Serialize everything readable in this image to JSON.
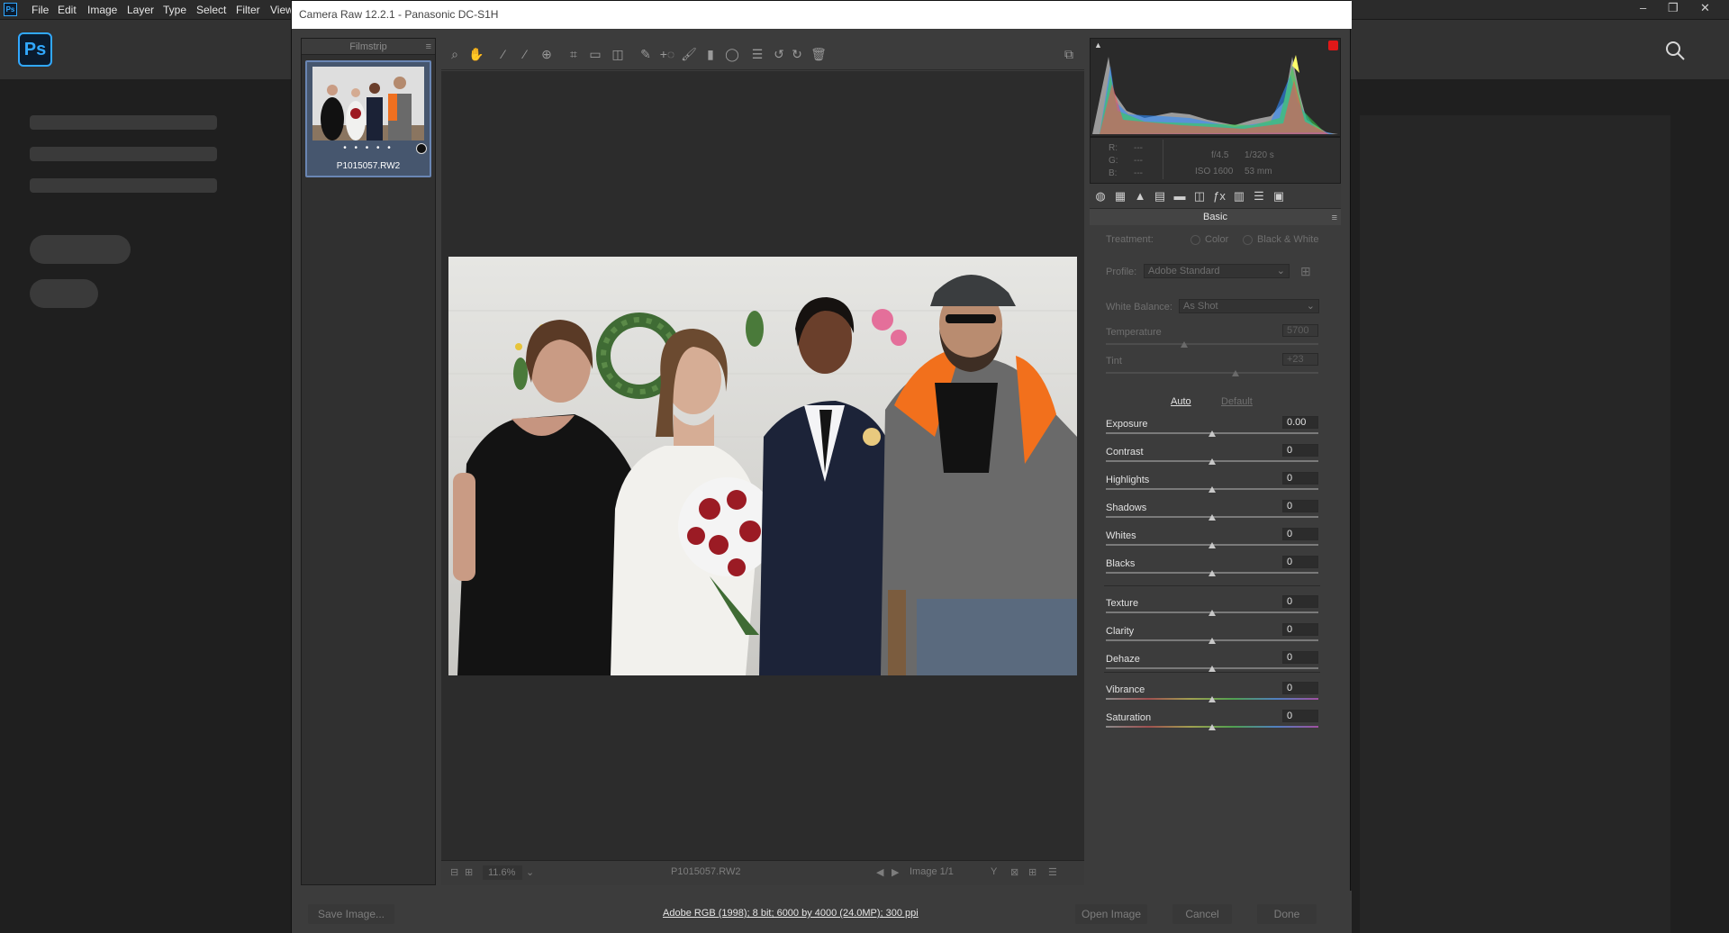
{
  "ps": {
    "logo_small": "Ps",
    "logo": "Ps",
    "menu": [
      "File",
      "Edit",
      "Image",
      "Layer",
      "Type",
      "Select",
      "Filter",
      "View"
    ]
  },
  "dialog": {
    "title": "Camera Raw 12.2.1  -  Panasonic DC-S1H",
    "filmstrip_label": "Filmstrip",
    "thumb_stars": "• • • • •",
    "thumb_name": "P1015057.RW2",
    "footer": {
      "zoom": "11.6%",
      "filename": "P1015057.RW2",
      "image_counter": "Image 1/1"
    },
    "info": {
      "r": "R:",
      "g": "G:",
      "b": "B:",
      "r_val": "---",
      "g_val": "---",
      "b_val": "---",
      "aperture": "f/4.5",
      "shutter": "1/320 s",
      "iso": "ISO 1600",
      "focal": "53 mm"
    },
    "panel": {
      "title": "Basic",
      "treatment_label": "Treatment:",
      "treatment_color": "Color",
      "treatment_bw": "Black & White",
      "profile_label": "Profile:",
      "profile_value": "Adobe Standard",
      "wb_label": "White Balance:",
      "wb_value": "As Shot",
      "temperature_label": "Temperature",
      "temperature_value": "5700",
      "tint_label": "Tint",
      "tint_value": "+23",
      "auto": "Auto",
      "default": "Default",
      "sliders": [
        {
          "label": "Exposure",
          "value": "0.00",
          "pos": 0.5
        },
        {
          "label": "Contrast",
          "value": "0",
          "pos": 0.5
        },
        {
          "label": "Highlights",
          "value": "0",
          "pos": 0.5
        },
        {
          "label": "Shadows",
          "value": "0",
          "pos": 0.5
        },
        {
          "label": "Whites",
          "value": "0",
          "pos": 0.5
        },
        {
          "label": "Blacks",
          "value": "0",
          "pos": 0.5
        }
      ],
      "sliders2": [
        {
          "label": "Texture",
          "value": "0",
          "pos": 0.5
        },
        {
          "label": "Clarity",
          "value": "0",
          "pos": 0.5
        },
        {
          "label": "Dehaze",
          "value": "0",
          "pos": 0.5
        }
      ],
      "sliders3": [
        {
          "label": "Vibrance",
          "value": "0",
          "pos": 0.5
        },
        {
          "label": "Saturation",
          "value": "0",
          "pos": 0.5
        }
      ],
      "temp_pos": 0.37,
      "tint_pos": 0.61
    },
    "bottom": {
      "save": "Save Image...",
      "workflow": "Adobe RGB (1998); 8 bit; 6000 by 4000 (24.0MP); 300 ppi",
      "open": "Open Image",
      "cancel": "Cancel",
      "done": "Done"
    }
  },
  "colors": {
    "accent": "#31a8ff",
    "selection": "#6a86b4"
  }
}
